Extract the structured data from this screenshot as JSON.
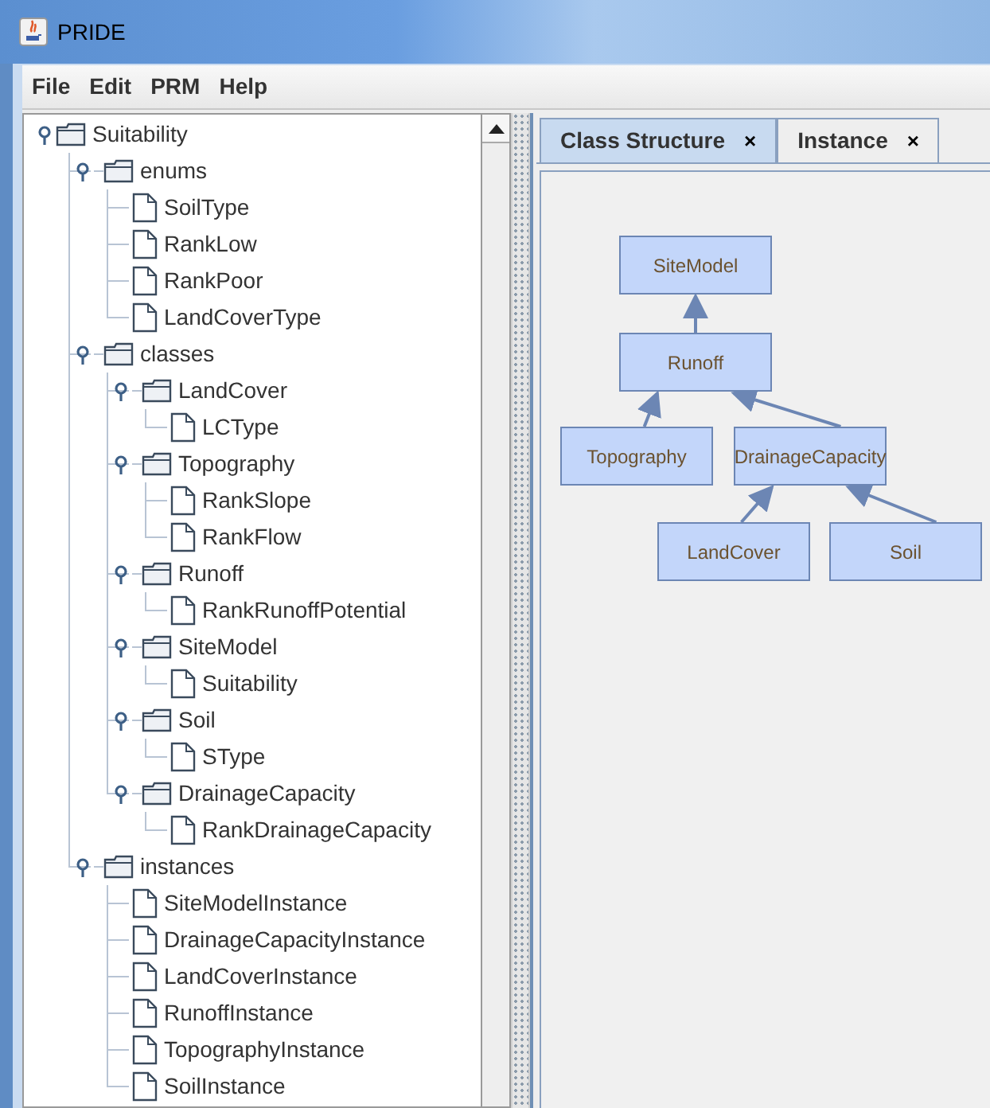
{
  "window": {
    "title": "PRIDE"
  },
  "menu": [
    "File",
    "Edit",
    "PRM",
    "Help"
  ],
  "tree": [
    {
      "label": "Suitability",
      "expanded": true,
      "children": [
        {
          "label": "enums",
          "expanded": true,
          "children": [
            {
              "label": "SoilType"
            },
            {
              "label": "RankLow"
            },
            {
              "label": "RankPoor"
            },
            {
              "label": "LandCoverType"
            }
          ]
        },
        {
          "label": "classes",
          "expanded": true,
          "children": [
            {
              "label": "LandCover",
              "expanded": true,
              "children": [
                {
                  "label": "LCType"
                }
              ]
            },
            {
              "label": "Topography",
              "expanded": true,
              "children": [
                {
                  "label": "RankSlope"
                },
                {
                  "label": "RankFlow"
                }
              ]
            },
            {
              "label": "Runoff",
              "expanded": true,
              "children": [
                {
                  "label": "RankRunoffPotential"
                }
              ]
            },
            {
              "label": "SiteModel",
              "expanded": true,
              "children": [
                {
                  "label": "Suitability"
                }
              ]
            },
            {
              "label": "Soil",
              "expanded": true,
              "children": [
                {
                  "label": "SType"
                }
              ]
            },
            {
              "label": "DrainageCapacity",
              "expanded": true,
              "children": [
                {
                  "label": "RankDrainageCapacity"
                }
              ]
            }
          ]
        },
        {
          "label": "instances",
          "expanded": true,
          "children": [
            {
              "label": "SiteModelInstance"
            },
            {
              "label": "DrainageCapacityInstance"
            },
            {
              "label": "LandCoverInstance"
            },
            {
              "label": "RunoffInstance"
            },
            {
              "label": "TopographyInstance"
            },
            {
              "label": "SoilInstance"
            }
          ]
        }
      ]
    }
  ],
  "tabs": [
    {
      "label": "Class Structure",
      "close": "×",
      "selected": true
    },
    {
      "label": "Instance",
      "close": "×",
      "selected": false
    }
  ],
  "diagram": {
    "root": {
      "label": "SiteModel",
      "children": [
        {
          "label": "Runoff",
          "children": [
            {
              "label": "Topography"
            },
            {
              "label": "DrainageCapacity",
              "children": [
                {
                  "label": "LandCover"
                },
                {
                  "label": "Soil"
                }
              ]
            }
          ]
        }
      ]
    }
  }
}
